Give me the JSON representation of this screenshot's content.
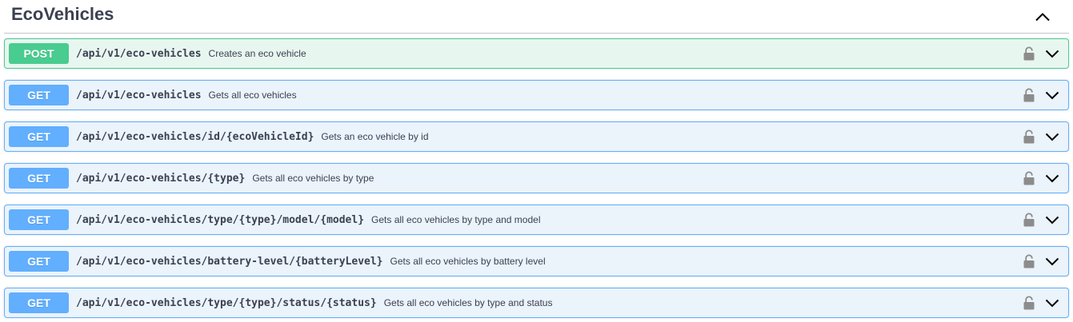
{
  "tag": {
    "title": "EcoVehicles",
    "collapse_icon": "chevron-up-icon"
  },
  "colors": {
    "post": "#49cc90",
    "post_bg": "#e8f6f0",
    "get": "#61affe",
    "get_bg": "#ebf3fb",
    "text": "#3b4151",
    "lock": "#8c8c8c"
  },
  "operations": [
    {
      "method": "POST",
      "path": "/api/v1/eco-vehicles",
      "summary": "Creates an eco vehicle",
      "lock_icon": "lock-icon",
      "expand_icon": "chevron-down-icon"
    },
    {
      "method": "GET",
      "path": "/api/v1/eco-vehicles",
      "summary": "Gets all eco vehicles",
      "lock_icon": "lock-icon",
      "expand_icon": "chevron-down-icon"
    },
    {
      "method": "GET",
      "path": "/api/v1/eco-vehicles/id/{ecoVehicleId}",
      "summary": "Gets an eco vehicle by id",
      "lock_icon": "lock-icon",
      "expand_icon": "chevron-down-icon"
    },
    {
      "method": "GET",
      "path": "/api/v1/eco-vehicles/{type}",
      "summary": "Gets all eco vehicles by type",
      "lock_icon": "lock-icon",
      "expand_icon": "chevron-down-icon"
    },
    {
      "method": "GET",
      "path": "/api/v1/eco-vehicles/type/{type}/model/{model}",
      "summary": "Gets all eco vehicles by type and model",
      "lock_icon": "lock-icon",
      "expand_icon": "chevron-down-icon"
    },
    {
      "method": "GET",
      "path": "/api/v1/eco-vehicles/battery-level/{batteryLevel}",
      "summary": "Gets all eco vehicles by battery level",
      "lock_icon": "lock-icon",
      "expand_icon": "chevron-down-icon"
    },
    {
      "method": "GET",
      "path": "/api/v1/eco-vehicles/type/{type}/status/{status}",
      "summary": "Gets all eco vehicles by type and status",
      "lock_icon": "lock-icon",
      "expand_icon": "chevron-down-icon"
    }
  ]
}
